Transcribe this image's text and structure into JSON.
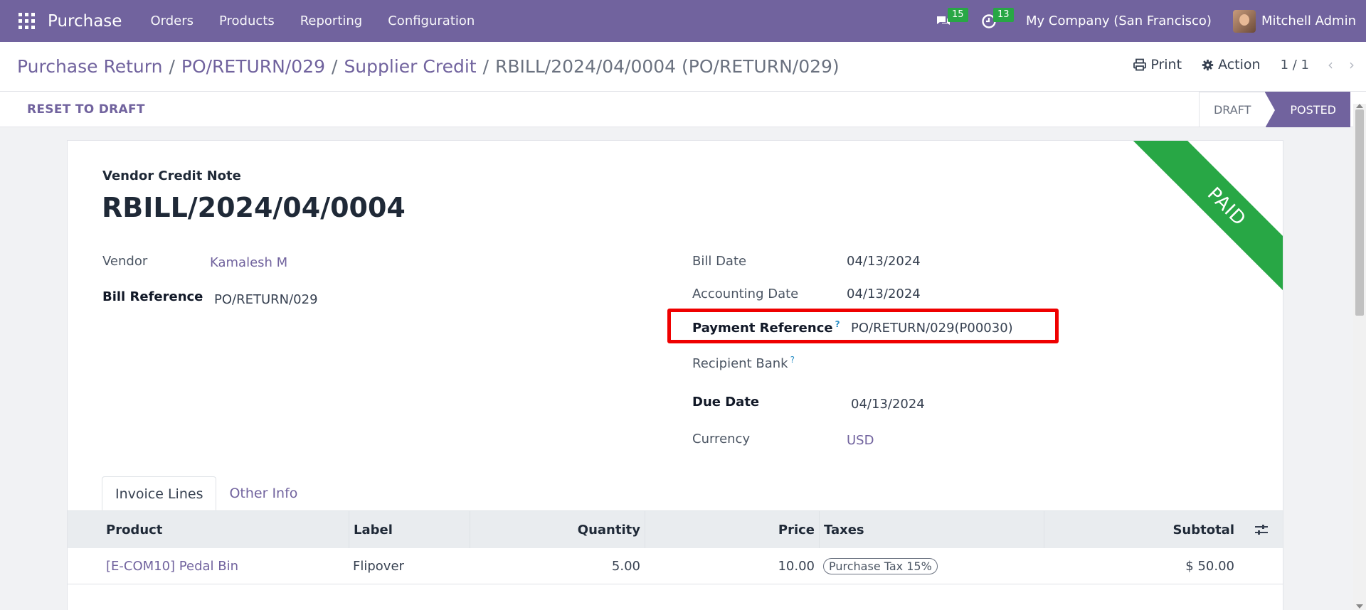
{
  "navbar": {
    "app_name": "Purchase",
    "menu": [
      "Orders",
      "Products",
      "Reporting",
      "Configuration"
    ],
    "messages_count": "15",
    "activities_count": "13",
    "company": "My Company (San Francisco)",
    "user": "Mitchell Admin"
  },
  "breadcrumb": {
    "items": [
      "Purchase Return",
      "PO/RETURN/029",
      "Supplier Credit"
    ],
    "current": "RBILL/2024/04/0004 (PO/RETURN/029)",
    "separator": "/"
  },
  "control": {
    "print_label": "Print",
    "action_label": "Action",
    "pager": "1 / 1"
  },
  "statusbar": {
    "reset_label": "RESET TO DRAFT",
    "states": [
      "DRAFT",
      "POSTED"
    ],
    "active_state": "POSTED"
  },
  "sheet": {
    "ribbon": "PAID",
    "doc_type": "Vendor Credit Note",
    "doc_name": "RBILL/2024/04/0004"
  },
  "fields": {
    "vendor_label": "Vendor",
    "vendor_value": "Kamalesh M",
    "bill_ref_label": "Bill Reference",
    "bill_ref_value": "PO/RETURN/029",
    "bill_date_label": "Bill Date",
    "bill_date_value": "04/13/2024",
    "acc_date_label": "Accounting Date",
    "acc_date_value": "04/13/2024",
    "payment_ref_label": "Payment Reference",
    "payment_ref_value": "PO/RETURN/029(P00030)",
    "recipient_bank_label": "Recipient Bank",
    "due_date_label": "Due Date",
    "due_date_value": "04/13/2024",
    "currency_label": "Currency",
    "currency_value": "USD",
    "help_mark": "?"
  },
  "tabs": [
    "Invoice Lines",
    "Other Info"
  ],
  "lines": {
    "headers": {
      "product": "Product",
      "label": "Label",
      "quantity": "Quantity",
      "price": "Price",
      "taxes": "Taxes",
      "subtotal": "Subtotal"
    },
    "rows": [
      {
        "product": "[E-COM10] Pedal Bin",
        "label": "Flipover",
        "quantity": "5.00",
        "price": "10.00",
        "tax": "Purchase Tax 15%",
        "subtotal": "$ 50.00"
      }
    ]
  },
  "colors": {
    "brand": "#71639e",
    "paid_ribbon": "#28a745",
    "highlight": "#ef0000"
  }
}
